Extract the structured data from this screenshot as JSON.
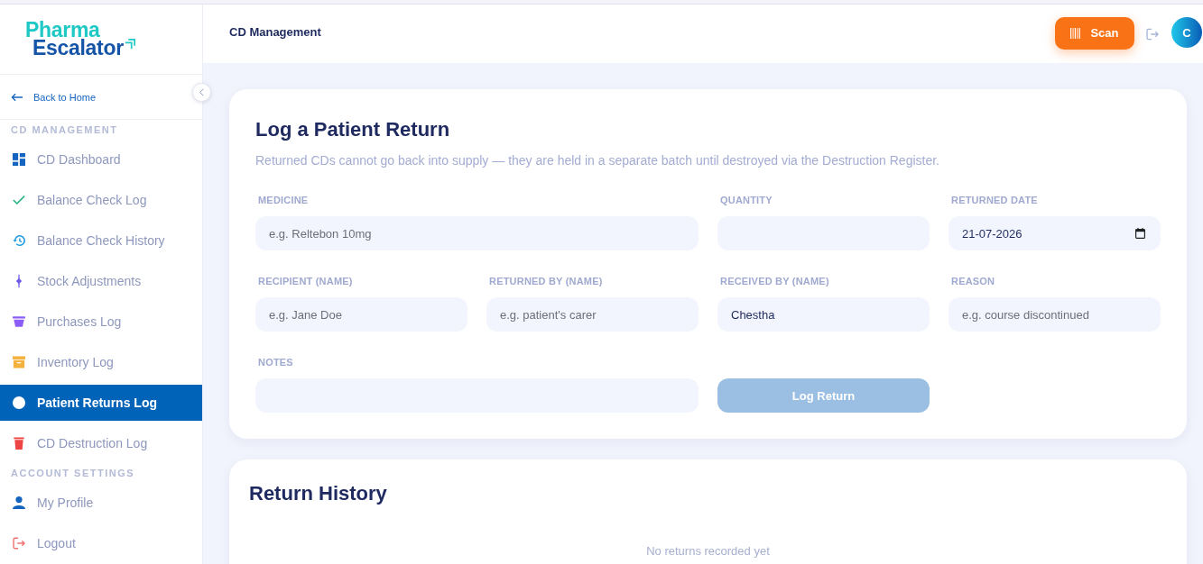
{
  "header": {
    "title": "CD Management",
    "scan_button": "Scan",
    "avatar": "C"
  },
  "sidebar": {
    "logo": {
      "line_1": "Pharma",
      "line_2": "Escalator"
    },
    "back_link": "Back to Home",
    "sections": [
      {
        "title": "CD MANAGEMENT",
        "items": [
          {
            "label": "CD Dashboard",
            "selected": false
          },
          {
            "label": "Balance Check Log",
            "selected": false
          },
          {
            "label": "Balance Check History",
            "selected": false
          },
          {
            "label": "Stock Adjustments",
            "selected": false
          },
          {
            "label": "Purchases Log",
            "selected": false
          },
          {
            "label": "Inventory Log",
            "selected": false
          },
          {
            "label": "Patient Returns Log",
            "selected": true
          },
          {
            "label": "CD Destruction Log",
            "selected": false
          }
        ]
      },
      {
        "title": "ACCOUNT SETTINGS",
        "items": [
          {
            "label": "My Profile",
            "selected": false
          },
          {
            "label": "Logout",
            "selected": false
          }
        ]
      }
    ]
  },
  "return_form": {
    "title": "Log a Patient Return",
    "subtitle": "Returned CDs cannot go back into supply — they are held in a separate batch until destroyed via the Destruction Register.",
    "fields": [
      {
        "label": "MEDICINE",
        "kind": "text",
        "placeholder": "e.g. Reltebon 10mg"
      },
      {
        "label": "QUANTITY",
        "kind": "text"
      },
      {
        "label": "RETURNED DATE",
        "kind": "date",
        "value": "21-07-2026"
      },
      {
        "label": "RECIPIENT (NAME)",
        "kind": "text",
        "placeholder": "e.g. Jane Doe"
      },
      {
        "label": "RETURNED BY (NAME)",
        "kind": "text",
        "placeholder": "e.g. patient's carer"
      },
      {
        "label": "RECEIVED BY (NAME)",
        "kind": "text",
        "value": "Chestha"
      },
      {
        "label": "REASON",
        "kind": "text",
        "placeholder": "e.g. course discontinued"
      },
      {
        "label": "NOTES",
        "kind": "text"
      }
    ],
    "submit_button": {
      "label": "Log Return",
      "disabled": true
    }
  },
  "return_history": {
    "title": "Return History",
    "empty_message": "No returns recorded yet"
  }
}
